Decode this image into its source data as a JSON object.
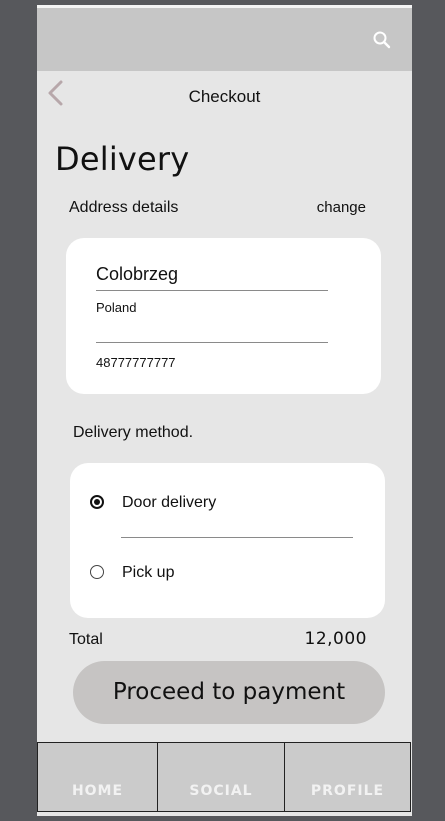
{
  "header": {
    "title": "Checkout",
    "search_icon": "search-icon",
    "back_icon": "chevron-left-icon"
  },
  "delivery": {
    "heading": "Delivery",
    "address_label": "Address details",
    "change_label": "change",
    "address": {
      "city": "Colobrzeg",
      "country": "Poland",
      "phone": "48777777777"
    }
  },
  "delivery_method": {
    "label": "Delivery method.",
    "options": [
      {
        "label": "Door delivery",
        "selected": true
      },
      {
        "label": "Pick up",
        "selected": false
      }
    ]
  },
  "total": {
    "label": "Total",
    "value": "12,000"
  },
  "proceed_label": "Proceed to payment",
  "nav": {
    "tabs": [
      {
        "label": "HOME"
      },
      {
        "label": "SOCIAL"
      },
      {
        "label": "PROFILE"
      }
    ]
  },
  "colors": {
    "page_bg": "#57585c",
    "screen_bg": "#e6e6e6",
    "topbar_bg": "#c6c6c6",
    "card_bg": "#ffffff",
    "button_bg": "#c6c4c3",
    "back_icon_color": "#b7a7aa"
  }
}
